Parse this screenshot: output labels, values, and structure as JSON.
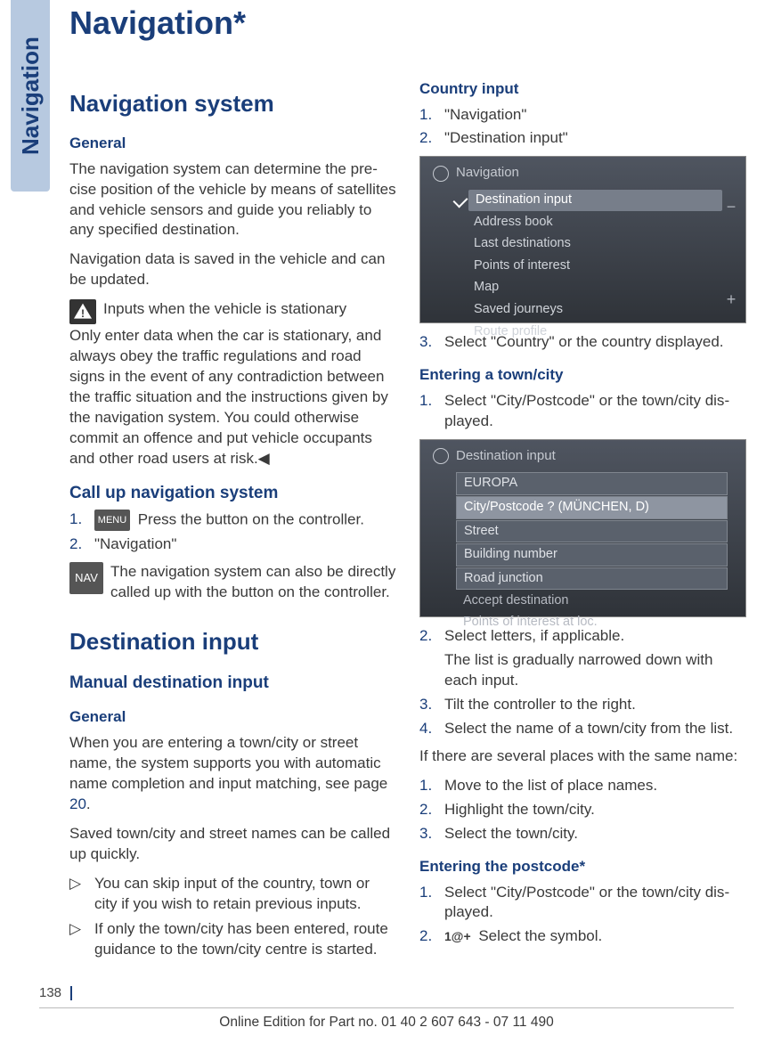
{
  "sideTab": "Navigation",
  "title": "Navigation*",
  "left": {
    "h2a": "Navigation system",
    "h4a": "General",
    "p1": "The navigation system can determine the pre­cise position of the vehicle by means of satellites and vehicle sensors and guide you reliably to any specified destination.",
    "p2": "Navigation data is saved in the vehicle and can be updated.",
    "warnTitle": "Inputs when the vehicle is stationary",
    "warnBody": "Only enter data when the car is stationary, and always obey the traffic regulations and road signs in the event of any contradiction between the traffic situation and the instructions given by the navigation system. You could otherwise commit an offence and put vehicle occupants and other road users at risk.◀",
    "h3b": "Call up navigation system",
    "menuLabel": "MENU",
    "step1": " Press the button on the controller.",
    "step2": "\"Navigation\"",
    "navIconLabel": "NAV",
    "navTip": "The navigation system can also be directly called up with the button on the controller.",
    "h2b": "Destination input",
    "h3c": "Manual destination input",
    "h4b": "General",
    "p3a": "When you are entering a town/city or street name, the system supports you with automatic name completion and input matching, see page ",
    "p3link": "20",
    "p3b": ".",
    "p4": "Saved town/city and street names can be called up quickly.",
    "bul1": "You can skip input of the country, town or city if you wish to retain previous inputs.",
    "bul2": "If only the town/city has been entered, route guidance to the town/city centre is started."
  },
  "right": {
    "h4a": "Country input",
    "ci1": "\"Navigation\"",
    "ci2": "\"Destination input\"",
    "shot1Title": "Navigation",
    "shot1Items": [
      "Destination input",
      "Address book",
      "Last destinations",
      "Points of interest",
      "Map",
      "Saved journeys",
      "Route profile"
    ],
    "ci3": "Select \"Country\" or the country displayed.",
    "h4b": "Entering a town/city",
    "tc1": "Select \"City/Postcode\" or the town/city dis­played.",
    "shot2Title": "Destination input",
    "shot2Items": [
      "EUROPA",
      "City/Postcode ? (MÜNCHEN, D)",
      "Street",
      "Building number",
      "Road junction",
      "Accept destination",
      "Points of interest at loc."
    ],
    "tc2a": "Select letters, if applicable.",
    "tc2b": "The list is gradually narrowed down with each input.",
    "tc3": "Tilt the controller to the right.",
    "tc4": "Select the name of a town/city from the list.",
    "p5": "If there are several places with the same name:",
    "sm1": "Move to the list of place names.",
    "sm2": "Highlight the town/city.",
    "sm3": "Select the town/city.",
    "h4c": "Entering the postcode*",
    "pc1": "Select \"City/Postcode\" or the town/city dis­played.",
    "pc2sym": "1@+",
    "pc2": " Select the symbol."
  },
  "footer": {
    "pageNum": "138",
    "line": "Online Edition for Part no. 01 40 2 607 643 - 07 11 490"
  }
}
